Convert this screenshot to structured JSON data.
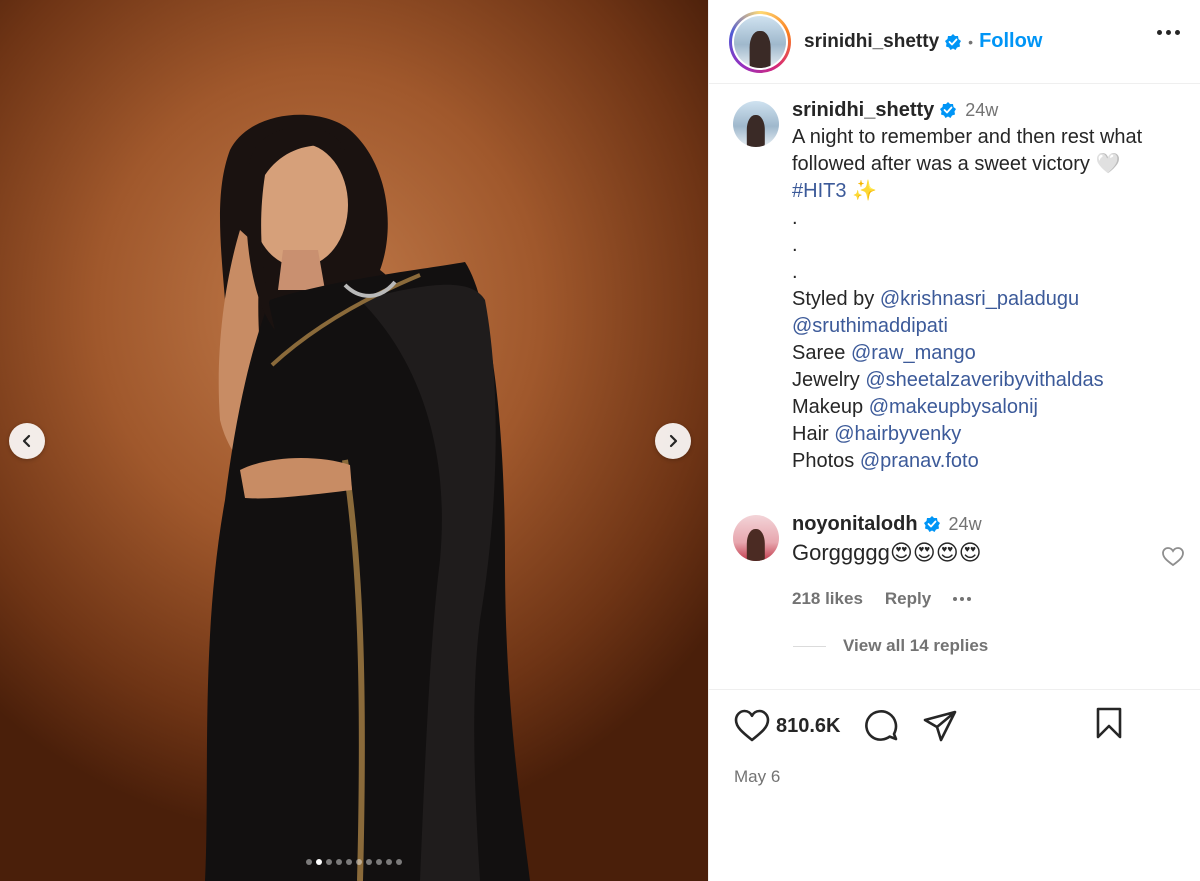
{
  "post": {
    "author": "srinidhi_shetty",
    "follow_label": "Follow",
    "separator": "•",
    "likes": "810.6K",
    "date": "May 6",
    "carousel": {
      "total": 10,
      "active_index": 1
    }
  },
  "caption": {
    "username": "srinidhi_shetty",
    "time": "24w",
    "line1": "A night to remember and then rest what",
    "line2": "followed after was a sweet victory 🤍",
    "hashtag": "#HIT3",
    "sparkle": "✨",
    "dots": [
      ".",
      ".",
      "."
    ],
    "credits": [
      {
        "label": "Styled by",
        "handle": "@krishnasri_paladugu"
      },
      {
        "label": "",
        "handle": "@sruthimaddipati"
      },
      {
        "label": "Saree",
        "handle": "@raw_mango"
      },
      {
        "label": "Jewelry",
        "handle": "@sheetalzaveribyvithaldas"
      },
      {
        "label": "Makeup",
        "handle": "@makeupbysalonij"
      },
      {
        "label": "Hair",
        "handle": "@hairbyvenky"
      },
      {
        "label": "Photos",
        "handle": "@pranav.foto"
      }
    ]
  },
  "comment": {
    "username": "noyonitalodh",
    "time": "24w",
    "text": "Gorggggg😍😍😍😍",
    "likes": "218 likes",
    "reply_label": "Reply",
    "view_replies": "View all 14 replies"
  },
  "colors": {
    "link": "#3c5a99",
    "follow": "#0095f6",
    "verified": "#0095f6",
    "muted": "#737373"
  },
  "icons": [
    "chevron-left-icon",
    "chevron-right-icon",
    "verified-badge-icon",
    "more-icon",
    "heart-icon",
    "comment-icon",
    "share-icon",
    "bookmark-icon"
  ]
}
